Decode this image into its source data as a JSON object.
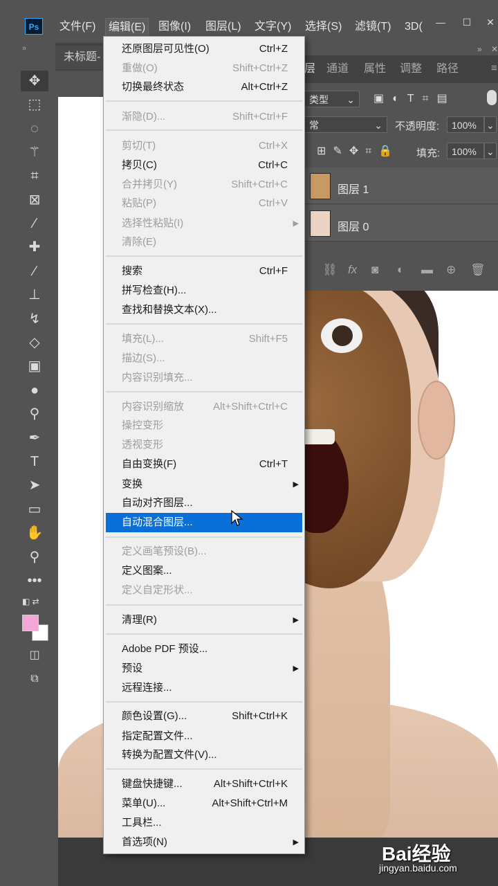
{
  "app": {
    "logo": "Ps"
  },
  "menubar": {
    "items": [
      "文件(F)",
      "编辑(E)",
      "图像(I)",
      "图层(L)",
      "文字(Y)",
      "选择(S)",
      "滤镜(T)",
      "3D("
    ],
    "active_index": 1
  },
  "document_tab": {
    "title": "未标题-"
  },
  "panel": {
    "tabs": [
      "层",
      "通道",
      "属性",
      "调整",
      "路径"
    ],
    "filter_label": "类型",
    "blend_mode": "常",
    "opacity_label": "不透明度:",
    "opacity_value": "100%",
    "fill_label": "填充:",
    "fill_value": "100%",
    "layers": [
      {
        "name": "图层 1"
      },
      {
        "name": "图层 0"
      }
    ]
  },
  "edit_menu": {
    "highlighted": "自动混合图层...",
    "groups": [
      [
        {
          "label": "还原图层可见性(O)",
          "shortcut": "Ctrl+Z",
          "enabled": true
        },
        {
          "label": "重做(O)",
          "shortcut": "Shift+Ctrl+Z",
          "enabled": false
        },
        {
          "label": "切换最终状态",
          "shortcut": "Alt+Ctrl+Z",
          "enabled": true
        }
      ],
      [
        {
          "label": "渐隐(D)...",
          "shortcut": "Shift+Ctrl+F",
          "enabled": false
        }
      ],
      [
        {
          "label": "剪切(T)",
          "shortcut": "Ctrl+X",
          "enabled": false
        },
        {
          "label": "拷贝(C)",
          "shortcut": "Ctrl+C",
          "enabled": true
        },
        {
          "label": "合并拷贝(Y)",
          "shortcut": "Shift+Ctrl+C",
          "enabled": false
        },
        {
          "label": "粘贴(P)",
          "shortcut": "Ctrl+V",
          "enabled": false
        },
        {
          "label": "选择性粘贴(I)",
          "shortcut": "",
          "enabled": false,
          "submenu": true
        },
        {
          "label": "清除(E)",
          "shortcut": "",
          "enabled": false
        }
      ],
      [
        {
          "label": "搜索",
          "shortcut": "Ctrl+F",
          "enabled": true
        },
        {
          "label": "拼写检查(H)...",
          "shortcut": "",
          "enabled": true
        },
        {
          "label": "查找和替换文本(X)...",
          "shortcut": "",
          "enabled": true
        }
      ],
      [
        {
          "label": "填充(L)...",
          "shortcut": "Shift+F5",
          "enabled": false
        },
        {
          "label": "描边(S)...",
          "shortcut": "",
          "enabled": false
        },
        {
          "label": "内容识别填充...",
          "shortcut": "",
          "enabled": false
        }
      ],
      [
        {
          "label": "内容识别缩放",
          "shortcut": "Alt+Shift+Ctrl+C",
          "enabled": false
        },
        {
          "label": "操控变形",
          "shortcut": "",
          "enabled": false
        },
        {
          "label": "透视变形",
          "shortcut": "",
          "enabled": false
        },
        {
          "label": "自由变换(F)",
          "shortcut": "Ctrl+T",
          "enabled": true
        },
        {
          "label": "变换",
          "shortcut": "",
          "enabled": true,
          "submenu": true
        },
        {
          "label": "自动对齐图层...",
          "shortcut": "",
          "enabled": true
        },
        {
          "label": "自动混合图层...",
          "shortcut": "",
          "enabled": true
        }
      ],
      [
        {
          "label": "定义画笔预设(B)...",
          "shortcut": "",
          "enabled": false
        },
        {
          "label": "定义图案...",
          "shortcut": "",
          "enabled": true
        },
        {
          "label": "定义自定形状...",
          "shortcut": "",
          "enabled": false
        }
      ],
      [
        {
          "label": "清理(R)",
          "shortcut": "",
          "enabled": true,
          "submenu": true
        }
      ],
      [
        {
          "label": "Adobe PDF 预设...",
          "shortcut": "",
          "enabled": true
        },
        {
          "label": "预设",
          "shortcut": "",
          "enabled": true,
          "submenu": true
        },
        {
          "label": "远程连接...",
          "shortcut": "",
          "enabled": true
        }
      ],
      [
        {
          "label": "颜色设置(G)...",
          "shortcut": "Shift+Ctrl+K",
          "enabled": true
        },
        {
          "label": "指定配置文件...",
          "shortcut": "",
          "enabled": true
        },
        {
          "label": "转换为配置文件(V)...",
          "shortcut": "",
          "enabled": true
        }
      ],
      [
        {
          "label": "键盘快捷键...",
          "shortcut": "Alt+Shift+Ctrl+K",
          "enabled": true
        },
        {
          "label": "菜单(U)...",
          "shortcut": "Alt+Shift+Ctrl+M",
          "enabled": true
        },
        {
          "label": "工具栏...",
          "shortcut": "",
          "enabled": true
        },
        {
          "label": "首选项(N)",
          "shortcut": "",
          "enabled": true,
          "submenu": true
        }
      ]
    ]
  },
  "tools": [
    "move-tool",
    "marquee-tool",
    "lasso-tool",
    "magic-wand-tool",
    "crop-tool",
    "frame-tool",
    "eyedropper-tool",
    "healing-brush-tool",
    "brush-tool",
    "clone-stamp-tool",
    "history-brush-tool",
    "eraser-tool",
    "gradient-tool",
    "blur-tool",
    "dodge-tool",
    "pen-tool",
    "type-tool",
    "path-selection-tool",
    "rectangle-tool",
    "hand-tool",
    "zoom-tool",
    "more-tools"
  ],
  "colors": {
    "foreground": "#f4a6d7",
    "background": "#ffffff",
    "highlight": "#0a6fd6"
  },
  "watermark": {
    "brand": "Bai经验",
    "url": "jingyan.baidu.com"
  }
}
